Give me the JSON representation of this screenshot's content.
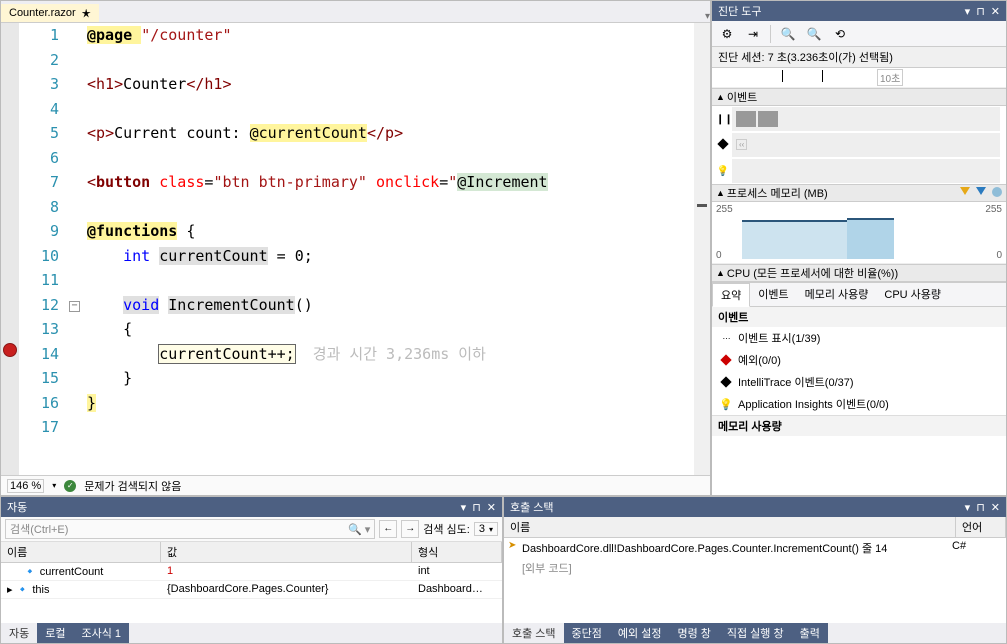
{
  "file_tab": {
    "name": "Counter.razor"
  },
  "code": {
    "line_count": 17,
    "breakpoint_line": 14,
    "fold_line": 12,
    "l1_a": "@page ",
    "l1_b": "\"/counter\"",
    "l3_a": "<",
    "l3_b": "h1",
    "l3_c": ">",
    "l3_d": "Counter",
    "l3_e": "</",
    "l3_f": "h1",
    "l3_g": ">",
    "l5_a": "<",
    "l5_b": "p",
    "l5_c": ">",
    "l5_d": "Current count: ",
    "l5_e": "@currentCount",
    "l5_f": "</",
    "l5_g": "p",
    "l5_h": ">",
    "l7_a": "<",
    "l7_b": "button ",
    "l7_c": "class",
    "l7_d": "=",
    "l7_e": "\"btn btn-primary\"",
    "l7_f": " ",
    "l7_g": "onclick",
    "l7_h": "=",
    "l7_i": "\"",
    "l7_j": "@Increment",
    "l9_a": "@functions",
    "l9_b": " {",
    "l10_a": "    ",
    "l10_b": "int",
    "l10_c": " ",
    "l10_d": "currentCount",
    "l10_e": " = 0;",
    "l12_a": "    ",
    "l12_b": "void",
    "l12_c": " ",
    "l12_d": "IncrementCount",
    "l12_e": "()",
    "l13": "    {",
    "l14_a": "        ",
    "l14_b": "currentCount++;",
    "l14_c": "  경과 시간 3,236ms 이하",
    "l15": "    }",
    "l16": "}"
  },
  "status": {
    "zoom": "146 %",
    "issues": "문제가 검색되지 않음"
  },
  "diag": {
    "title": "진단 도구",
    "session": "진단 세션: 7 초(3.236초이(가) 선택됨)",
    "ruler_ten": "10초",
    "events_hd": "이벤트",
    "mem_hd": "프로세스 메모리 (MB)",
    "cpu_hd": "CPU (모든 프로세서에 대한 비율(%))",
    "mem_max": "255",
    "mem_min": "0",
    "tabs": {
      "summary": "요약",
      "events": "이벤트",
      "memory": "메모리 사용량",
      "cpu": "CPU 사용량"
    },
    "evt_section": "이벤트",
    "items": {
      "show": "이벤트 표시(1/39)",
      "exception": "예외(0/0)",
      "intelli": "IntelliTrace 이벤트(0/37)",
      "insights": "Application Insights 이벤트(0/0)"
    },
    "mem_footer": "메모리 사용량"
  },
  "autos": {
    "title": "자동",
    "search_ph": "검색(Ctrl+E)",
    "depth_lbl": "검색 심도:",
    "depth_val": "3",
    "hdr": {
      "name": "이름",
      "value": "값",
      "type": "형식"
    },
    "rows": [
      {
        "name": "currentCount",
        "value": "1",
        "type": "int",
        "red": true
      },
      {
        "name": "this",
        "value": "{DashboardCore.Pages.Counter}",
        "type": "Dashboard…"
      }
    ],
    "tabs": {
      "auto": "자동",
      "locals": "로컬",
      "watch": "조사식 1"
    }
  },
  "stack": {
    "title": "호출 스택",
    "hdr": {
      "name": "이름",
      "lang": "언어"
    },
    "frame": "DashboardCore.dll!DashboardCore.Pages.Counter.IncrementCount() 줄 14",
    "external": "[외부 코드]",
    "lang": "C#",
    "tabs": {
      "stack": "호출 스택",
      "bp": "중단점",
      "exc": "예외 설정",
      "cmd": "명령 창",
      "imm": "직접 실행 창",
      "out": "출력"
    }
  }
}
